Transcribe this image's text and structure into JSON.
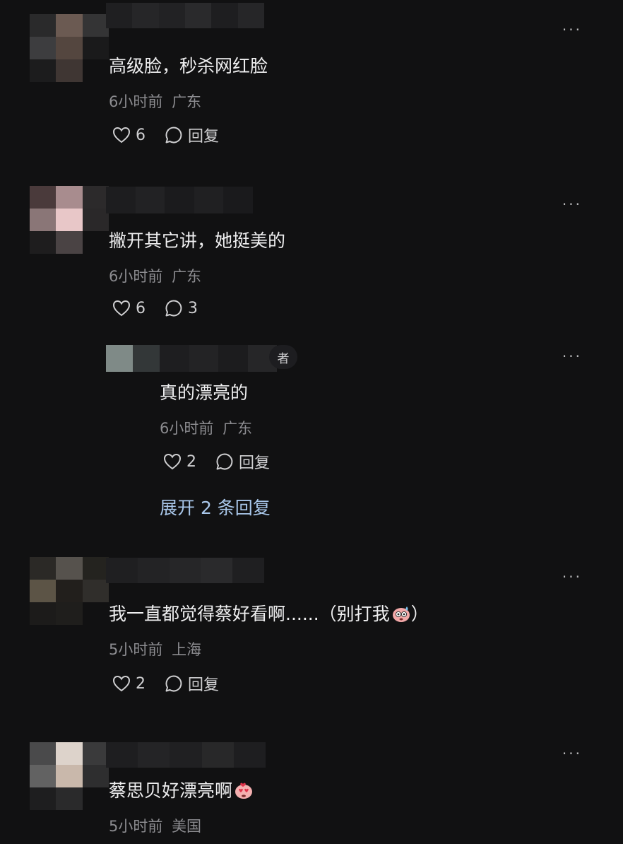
{
  "comments": [
    {
      "text": "高级脸，秒杀网红脸",
      "time": "6小时前",
      "location": "广东",
      "likes": "6",
      "reply_label": "回复",
      "more": "···"
    },
    {
      "text": "撇开其它讲，她挺美的",
      "time": "6小时前",
      "location": "广东",
      "likes": "6",
      "reply_count": "3",
      "more": "···",
      "reply": {
        "badge": "者",
        "text": "真的漂亮的",
        "time": "6小时前",
        "location": "广东",
        "likes": "2",
        "reply_label": "回复",
        "more": "···"
      },
      "expand_label": "展开 2 条回复"
    },
    {
      "text": "我一直都觉得蔡好看啊......（别打我",
      "text_end": "）",
      "emoji": "sweat-face-emoji",
      "time": "5小时前",
      "location": "上海",
      "likes": "2",
      "reply_label": "回复",
      "more": "···"
    },
    {
      "text": "蔡思贝好漂亮啊",
      "emoji": "heart-eyes-face-emoji",
      "time": "5小时前",
      "location": "美国",
      "more": "···"
    }
  ],
  "colors": {
    "background": "#111112",
    "link": "#a9c7ea",
    "meta": "#8c8c90"
  }
}
